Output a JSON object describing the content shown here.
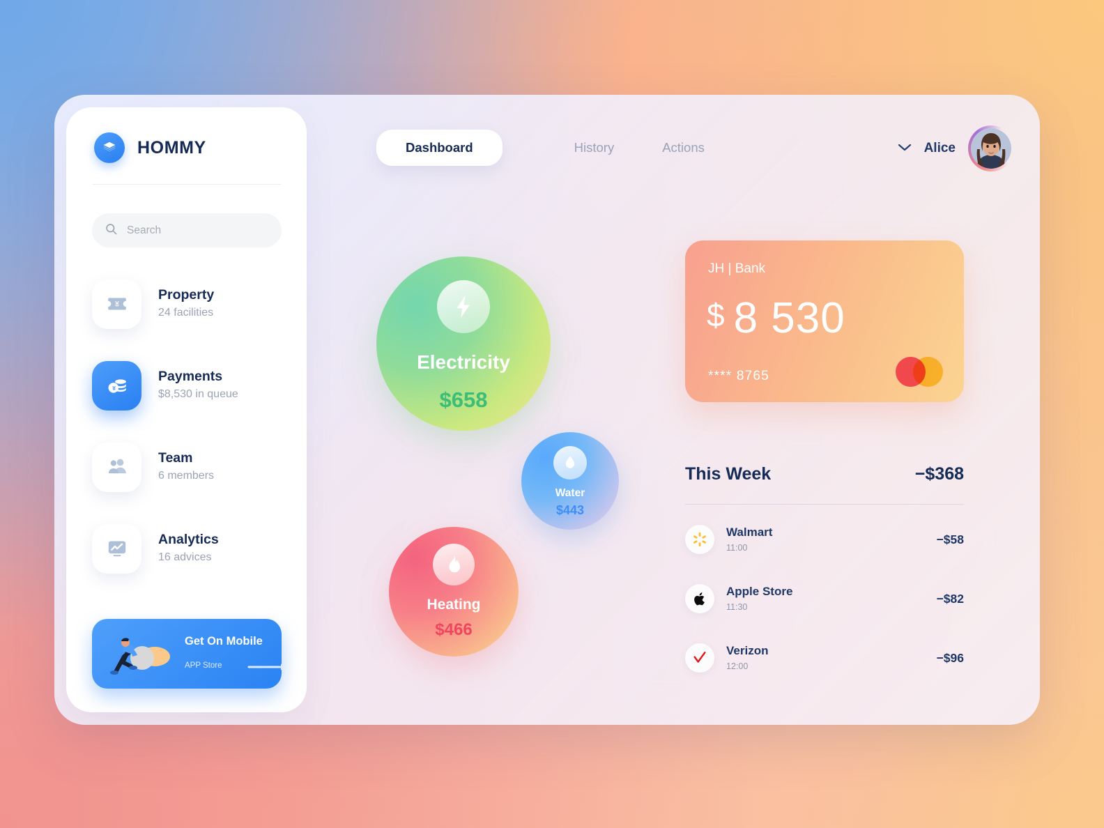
{
  "brand": {
    "name": "HOMMY",
    "logo_icon": "layers-icon"
  },
  "search": {
    "placeholder": "Search",
    "value": "",
    "icon": "search-icon"
  },
  "sidebar": {
    "items": [
      {
        "label": "Property",
        "sub": "24 facilities",
        "icon": "ticket-yen-icon",
        "active": false
      },
      {
        "label": "Payments",
        "sub": "$8,530 in queue",
        "icon": "coins-icon",
        "active": true
      },
      {
        "label": "Team",
        "sub": "6 members",
        "icon": "people-icon",
        "active": false
      },
      {
        "label": "Analytics",
        "sub": "16 advices",
        "icon": "chart-icon",
        "active": false
      }
    ],
    "promo": {
      "title": "Get On Mobile",
      "sub": "APP Store",
      "arrow_icon": "arrow-right-icon"
    }
  },
  "topbar": {
    "tabs": [
      {
        "label": "Dashboard",
        "active": true
      },
      {
        "label": "History",
        "active": false
      },
      {
        "label": "Actions",
        "active": false
      }
    ],
    "user": {
      "name": "Alice",
      "chevron_icon": "chevron-down-icon",
      "avatar_icon": "avatar"
    }
  },
  "utilities": [
    {
      "name": "Electricity",
      "amount": "$658",
      "icon": "bolt-icon",
      "color": "#3dbd75"
    },
    {
      "name": "Water",
      "amount": "$443",
      "icon": "drop-icon",
      "color": "#3e8ef7"
    },
    {
      "name": "Heating",
      "amount": "$466",
      "icon": "flame-icon",
      "color": "#f0455f"
    }
  ],
  "card": {
    "bank": "JH | Bank",
    "currency": "$",
    "amount": "8 530",
    "number": "**** 8765",
    "network_icon": "mastercard-icon"
  },
  "transactions": {
    "title": "This Week",
    "total": "−$368",
    "rows": [
      {
        "merchant": "Walmart",
        "time": "11:00",
        "amount": "−$58",
        "icon": "walmart-icon"
      },
      {
        "merchant": "Apple Store",
        "time": "11:30",
        "amount": "−$82",
        "icon": "apple-icon"
      },
      {
        "merchant": "Verizon",
        "time": "12:00",
        "amount": "−$96",
        "icon": "verizon-icon"
      }
    ]
  }
}
